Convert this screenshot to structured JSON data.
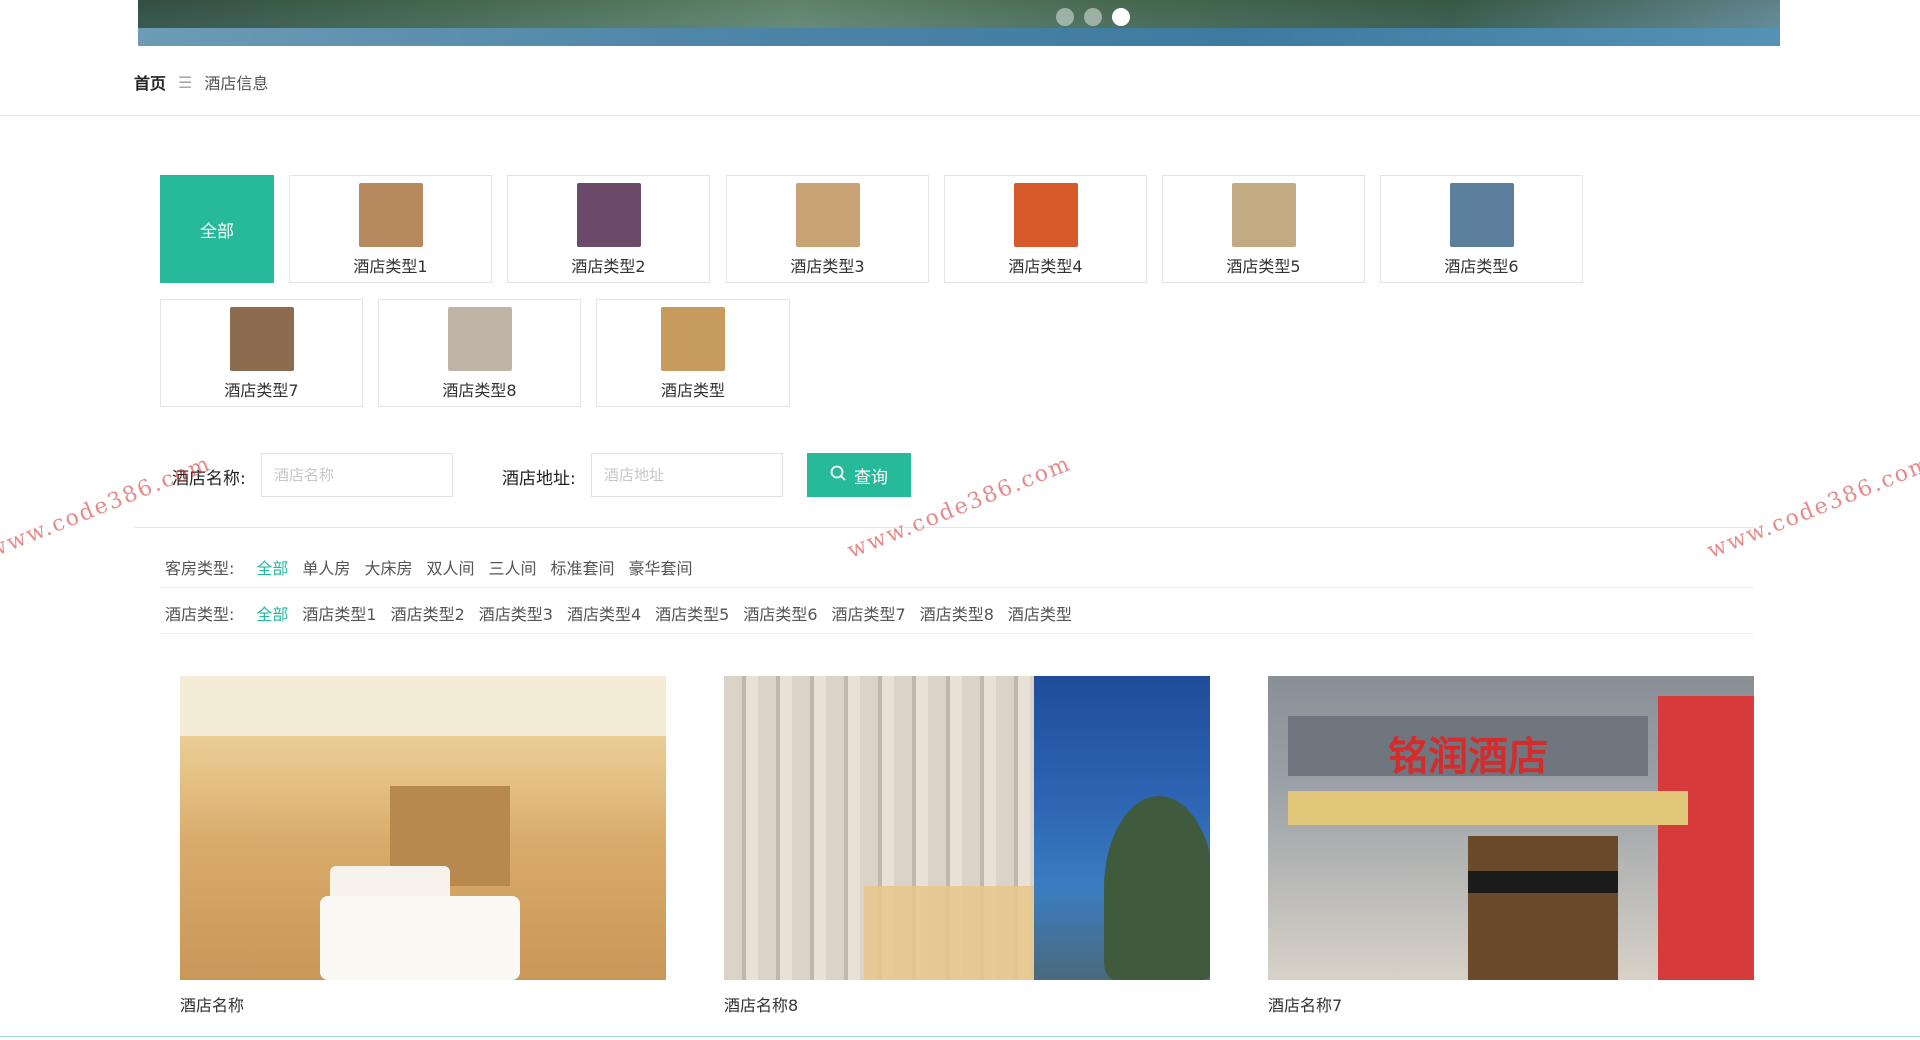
{
  "banner": {
    "dots": 3,
    "active_dot": 3
  },
  "breadcrumb": {
    "home": "首页",
    "separator": "☰",
    "current": "酒店信息"
  },
  "categories": [
    {
      "label": "全部",
      "active": true
    },
    {
      "label": "酒店类型1",
      "color": "#b68a5e"
    },
    {
      "label": "酒店类型2",
      "color": "#6b4a6a"
    },
    {
      "label": "酒店类型3",
      "color": "#c9a276"
    },
    {
      "label": "酒店类型4",
      "color": "#d65a2a"
    },
    {
      "label": "酒店类型5",
      "color": "#c2ab82"
    },
    {
      "label": "酒店类型6",
      "color": "#5b7f9c"
    },
    {
      "label": "酒店类型7",
      "color": "#8c6b4f"
    },
    {
      "label": "酒店类型8",
      "color": "#bfb4a6"
    },
    {
      "label": "酒店类型",
      "color": "#c79a5e"
    }
  ],
  "search": {
    "name_label": "酒店名称:",
    "name_placeholder": "酒店名称",
    "address_label": "酒店地址:",
    "address_placeholder": "酒店地址",
    "button_label": "查询",
    "button_icon": "search-icon"
  },
  "filters": {
    "room_type": {
      "title": "客房类型:",
      "options": [
        "全部",
        "单人房",
        "大床房",
        "双人间",
        "三人间",
        "标准套间",
        "豪华套间"
      ],
      "active": "全部"
    },
    "hotel_type": {
      "title": "酒店类型:",
      "options": [
        "全部",
        "酒店类型1",
        "酒店类型2",
        "酒店类型3",
        "酒店类型4",
        "酒店类型5",
        "酒店类型6",
        "酒店类型7",
        "酒店类型8",
        "酒店类型"
      ],
      "active": "全部"
    }
  },
  "hotels": [
    {
      "name": "酒店名称"
    },
    {
      "name": "酒店名称8"
    },
    {
      "name": "酒店名称7",
      "sign": "铭润酒店"
    }
  ],
  "watermark": "www.code386.com",
  "colors": {
    "accent": "#26b99a"
  }
}
